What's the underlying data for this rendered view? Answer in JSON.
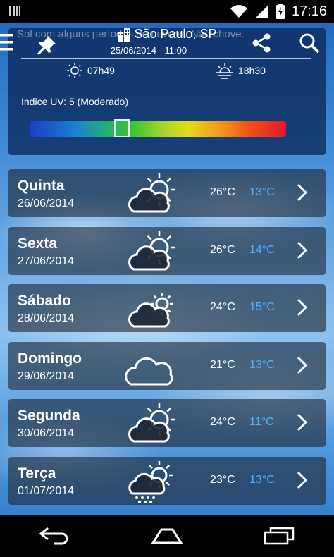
{
  "status_bar": {
    "time": "17:16"
  },
  "header": {
    "ticker": "Sol com alguns períodos de nuvens. Não chove.",
    "city": "São Paulo, SP",
    "datetime": "25/06/2014 - 11:00",
    "sunrise": "07h49",
    "sunset": "18h30",
    "uv_label": "Indice UV:  5 (Moderado)",
    "uv_index": 5,
    "uv_fraction": 0.36
  },
  "forecast": [
    {
      "day": "Quinta",
      "date": "26/06/2014",
      "max": "26°C",
      "min": "13°C",
      "icon": "sun-cloud-icon"
    },
    {
      "day": "Sexta",
      "date": "27/06/2014",
      "max": "26°C",
      "min": "14°C",
      "icon": "sun-cloud-icon"
    },
    {
      "day": "Sábado",
      "date": "28/06/2014",
      "max": "24°C",
      "min": "15°C",
      "icon": "cloud-sun-icon"
    },
    {
      "day": "Domingo",
      "date": "29/06/2014",
      "max": "21°C",
      "min": "13°C",
      "icon": "cloud-icon"
    },
    {
      "day": "Segunda",
      "date": "30/06/2014",
      "max": "24°C",
      "min": "11°C",
      "icon": "sun-cloud-icon"
    },
    {
      "day": "Terça",
      "date": "01/07/2014",
      "max": "23°C",
      "min": "13°C",
      "icon": "sun-cloud-rain-icon"
    }
  ],
  "colors": {
    "min_temp": "#4db0ff",
    "panel": "#0a285a"
  }
}
